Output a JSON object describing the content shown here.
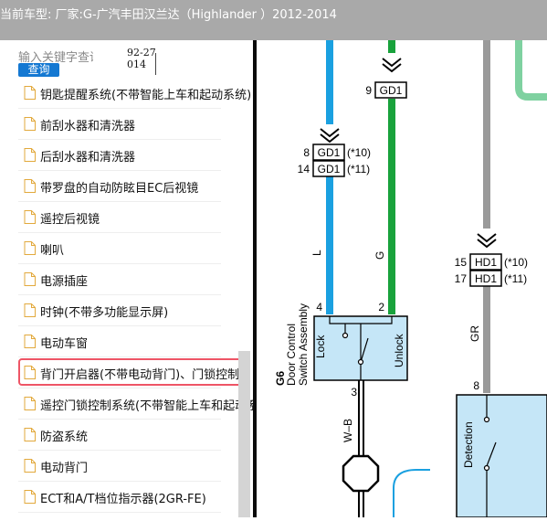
{
  "window": {
    "title": "当前车型:  厂家:G-广汽丰田汉兰达（Highlander ）2012-2014"
  },
  "sidebar": {
    "search": {
      "placeholder": "输入关键字查询",
      "button_label": "查询"
    },
    "code": "92-27014",
    "items": [
      {
        "label": "钥匙提醒系统(不带智能上车和起动系统)"
      },
      {
        "label": "前刮水器和清洗器"
      },
      {
        "label": "后刮水器和清洗器"
      },
      {
        "label": "带罗盘的自动防眩目EC后视镜"
      },
      {
        "label": "遥控后视镜"
      },
      {
        "label": "喇叭"
      },
      {
        "label": "电源插座"
      },
      {
        "label": "时钟(不带多功能显示屏)"
      },
      {
        "label": "电动车窗"
      },
      {
        "label": "背门开启器(不带电动背门)、门锁控制"
      },
      {
        "label": "遥控门锁控制系统(不带智能上车和起动系统)"
      },
      {
        "label": "防盗系统"
      },
      {
        "label": "电动背门"
      },
      {
        "label": "ECT和A/T档位指示器(2GR-FE)"
      }
    ],
    "selected_index": 9
  },
  "diagram": {
    "colors": {
      "blue_wire": "#1aa0e0",
      "green_wire": "#19a23c",
      "gray_wire": "#9a9a9a",
      "component_fill": "#c5e6f7",
      "light_green": "#7fd1a0"
    },
    "connectors": {
      "gd1_top": {
        "pin": "9",
        "name": "GD1"
      },
      "gd1_left_a": {
        "pin": "8",
        "name": "GD1",
        "note": "(*10)"
      },
      "gd1_left_b": {
        "pin": "14",
        "name": "GD1",
        "note": "(*11)"
      },
      "hd1_a": {
        "pin": "15",
        "name": "HD1",
        "note": "(*10)"
      },
      "hd1_b": {
        "pin": "17",
        "name": "HD1",
        "note": "(*11)"
      }
    },
    "wire_labels": {
      "blue": "L",
      "green": "G",
      "gray": "GR",
      "lower": "W–B"
    },
    "pins": {
      "switch_left": "4",
      "switch_right": "2",
      "switch_bottom": "3",
      "detection_top": "8"
    },
    "switch": {
      "code": "G6",
      "name_line1": "Door Control",
      "name_line2": "Switch Assembly",
      "lock_label": "Lock",
      "unlock_label": "Unlock"
    },
    "detection_label": "Detection"
  }
}
